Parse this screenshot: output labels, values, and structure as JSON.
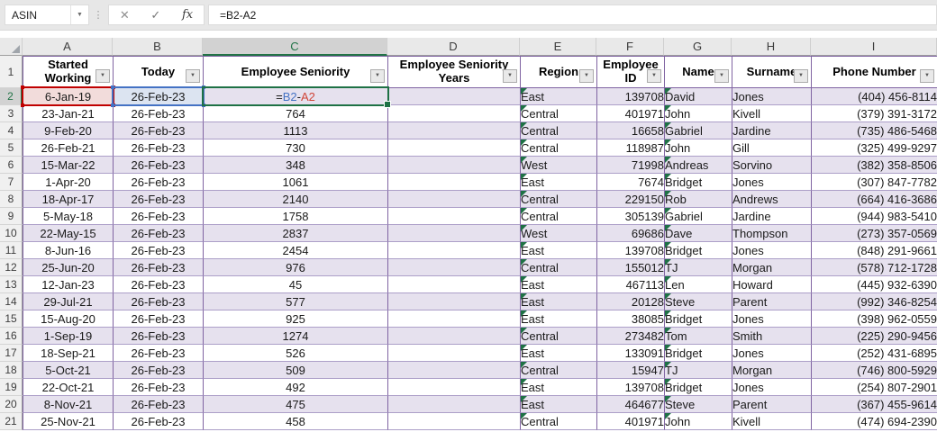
{
  "formula_bar": {
    "name_box_value": "ASIN",
    "formula": "=B2-A2"
  },
  "icons": {
    "name_box_dropdown": "▼",
    "separator": "⋮",
    "cancel": "✕",
    "enter": "✓",
    "function": "fx",
    "filter_dropdown": "▼",
    "error_indicator": "green-triangle"
  },
  "grid": {
    "column_letters": [
      "A",
      "B",
      "C",
      "D",
      "E",
      "F",
      "G",
      "H",
      "I"
    ],
    "selected_column": "C",
    "selected_row": 2,
    "first_row_number": 1
  },
  "colors": {
    "excel_green": "#217346",
    "band_fill": "#E6E1EE",
    "table_border": "#8064A2",
    "row_border": "#AC9FC8",
    "reference_blue": "#4472C4",
    "reference_red": "#C00000"
  },
  "table": {
    "headers": [
      "Started Working",
      "Today",
      "Employee Seniority",
      "Employee Seniority Years",
      "Region",
      "Employee ID",
      "Name",
      "Surname",
      "Phone Number"
    ],
    "active_cell_formula_parts": [
      {
        "text": "=",
        "color": "#1a1a1a"
      },
      {
        "text": "B2",
        "color": "#4472C4"
      },
      {
        "text": "-",
        "color": "#1a1a1a"
      },
      {
        "text": "A2",
        "color": "#D04437"
      }
    ],
    "rows": [
      {
        "row": 2,
        "cells": [
          "6-Jan-19",
          "26-Feb-23",
          "=B2-A2",
          "",
          "East",
          "139708",
          "David",
          "Jones",
          "(404) 456-8114"
        ]
      },
      {
        "row": 3,
        "cells": [
          "23-Jan-21",
          "26-Feb-23",
          "764",
          "",
          "Central",
          "401971",
          "John",
          "Kivell",
          "(379) 391-3172"
        ]
      },
      {
        "row": 4,
        "cells": [
          "9-Feb-20",
          "26-Feb-23",
          "1113",
          "",
          "Central",
          "16658",
          "Gabriel",
          "Jardine",
          "(735) 486-5468"
        ]
      },
      {
        "row": 5,
        "cells": [
          "26-Feb-21",
          "26-Feb-23",
          "730",
          "",
          "Central",
          "118987",
          "John",
          "Gill",
          "(325) 499-9297"
        ]
      },
      {
        "row": 6,
        "cells": [
          "15-Mar-22",
          "26-Feb-23",
          "348",
          "",
          "West",
          "71998",
          "Andreas",
          "Sorvino",
          "(382) 358-8506"
        ]
      },
      {
        "row": 7,
        "cells": [
          "1-Apr-20",
          "26-Feb-23",
          "1061",
          "",
          "East",
          "7674",
          "Bridget",
          "Jones",
          "(307) 847-7782"
        ]
      },
      {
        "row": 8,
        "cells": [
          "18-Apr-17",
          "26-Feb-23",
          "2140",
          "",
          "Central",
          "229150",
          "Rob",
          "Andrews",
          "(664) 416-3686"
        ]
      },
      {
        "row": 9,
        "cells": [
          "5-May-18",
          "26-Feb-23",
          "1758",
          "",
          "Central",
          "305139",
          "Gabriel",
          "Jardine",
          "(944) 983-5410"
        ]
      },
      {
        "row": 10,
        "cells": [
          "22-May-15",
          "26-Feb-23",
          "2837",
          "",
          "West",
          "69686",
          "Dave",
          "Thompson",
          "(273) 357-0569"
        ]
      },
      {
        "row": 11,
        "cells": [
          "8-Jun-16",
          "26-Feb-23",
          "2454",
          "",
          "East",
          "139708",
          "Bridget",
          "Jones",
          "(848) 291-9661"
        ]
      },
      {
        "row": 12,
        "cells": [
          "25-Jun-20",
          "26-Feb-23",
          "976",
          "",
          "Central",
          "155012",
          "TJ",
          "Morgan",
          "(578) 712-1728"
        ]
      },
      {
        "row": 13,
        "cells": [
          "12-Jan-23",
          "26-Feb-23",
          "45",
          "",
          "East",
          "467113",
          "Len",
          "Howard",
          "(445) 932-6390"
        ]
      },
      {
        "row": 14,
        "cells": [
          "29-Jul-21",
          "26-Feb-23",
          "577",
          "",
          "East",
          "20128",
          "Steve",
          "Parent",
          "(992) 346-8254"
        ]
      },
      {
        "row": 15,
        "cells": [
          "15-Aug-20",
          "26-Feb-23",
          "925",
          "",
          "East",
          "38085",
          "Bridget",
          "Jones",
          "(398) 962-0559"
        ]
      },
      {
        "row": 16,
        "cells": [
          "1-Sep-19",
          "26-Feb-23",
          "1274",
          "",
          "Central",
          "273482",
          "Tom",
          "Smith",
          "(225) 290-9456"
        ]
      },
      {
        "row": 17,
        "cells": [
          "18-Sep-21",
          "26-Feb-23",
          "526",
          "",
          "East",
          "133091",
          "Bridget",
          "Jones",
          "(252) 431-6895"
        ]
      },
      {
        "row": 18,
        "cells": [
          "5-Oct-21",
          "26-Feb-23",
          "509",
          "",
          "Central",
          "15947",
          "TJ",
          "Morgan",
          "(746) 800-5929"
        ]
      },
      {
        "row": 19,
        "cells": [
          "22-Oct-21",
          "26-Feb-23",
          "492",
          "",
          "East",
          "139708",
          "Bridget",
          "Jones",
          "(254) 807-2901"
        ]
      },
      {
        "row": 20,
        "cells": [
          "8-Nov-21",
          "26-Feb-23",
          "475",
          "",
          "East",
          "464677",
          "Steve",
          "Parent",
          "(367) 455-9614"
        ]
      },
      {
        "row": 21,
        "cells": [
          "25-Nov-21",
          "26-Feb-23",
          "458",
          "",
          "Central",
          "401971",
          "John",
          "Kivell",
          "(474) 694-2390"
        ]
      }
    ]
  }
}
